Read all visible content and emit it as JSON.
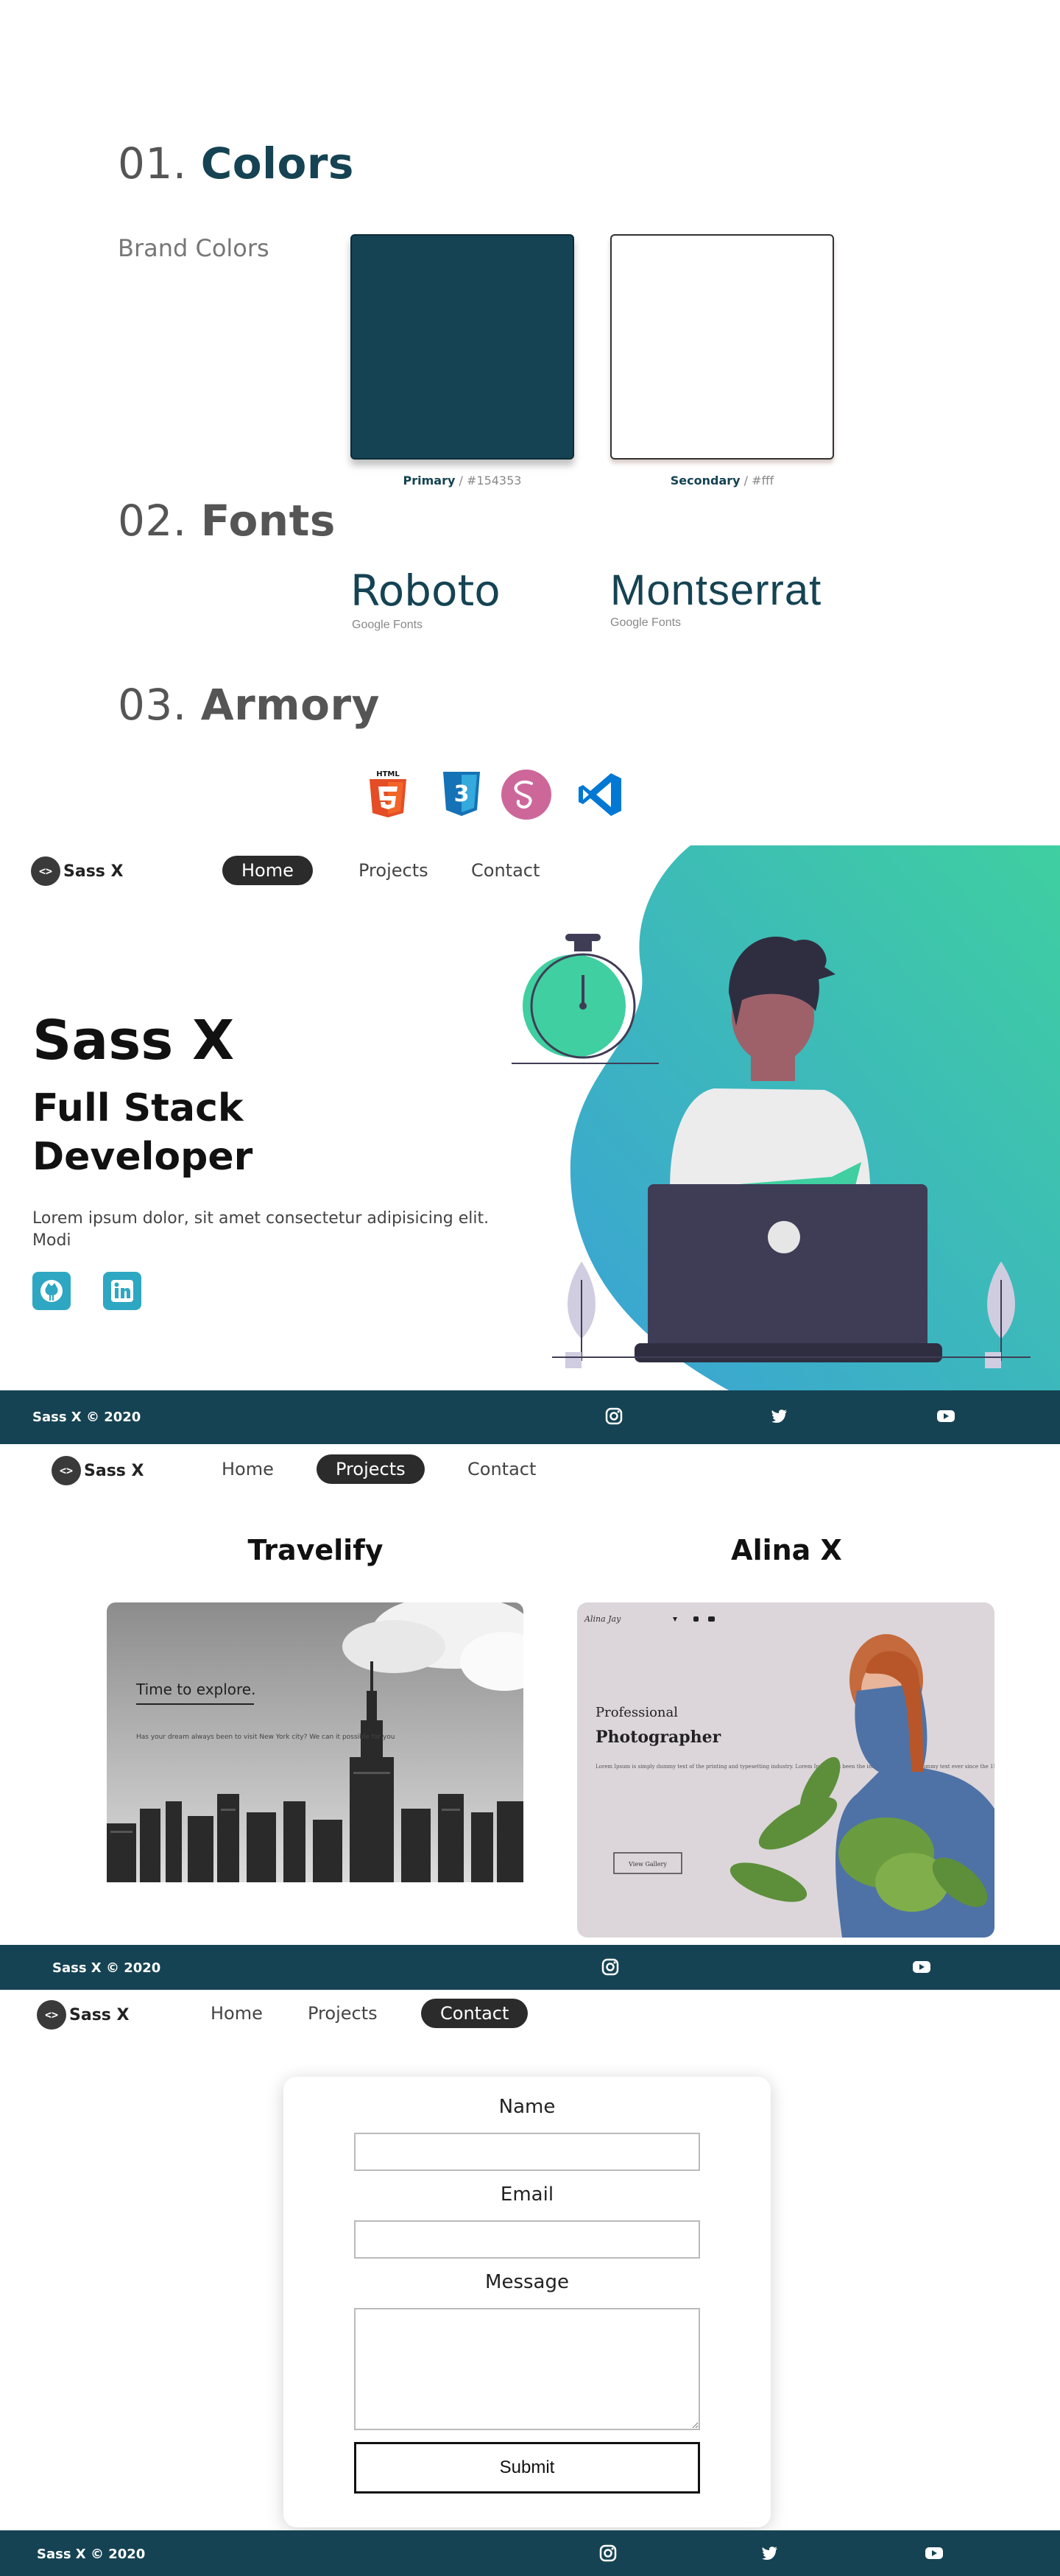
{
  "styleguide": {
    "colors": {
      "num": "01.",
      "name": "Colors",
      "brand_label": "Brand Colors",
      "primary": {
        "label": "Primary",
        "sep": " / ",
        "value": "#154353",
        "hex": "#154353"
      },
      "secondary": {
        "label": "Secondary",
        "sep": " / ",
        "value": "#fff",
        "hex": "#ffffff"
      }
    },
    "fonts": {
      "num": "02.",
      "name": "Fonts",
      "items": [
        {
          "name": "Roboto",
          "source": "Google Fonts"
        },
        {
          "name": "Montserrat",
          "source": "Google Fonts"
        }
      ]
    },
    "armory": {
      "num": "03.",
      "name": "Armory",
      "icons": [
        "html5-icon",
        "css3-icon",
        "sass-icon",
        "vscode-icon"
      ],
      "html5_text": "HTML"
    }
  },
  "brand": {
    "logo_glyph": "<>",
    "name": "Sass X"
  },
  "nav": {
    "home": "Home",
    "projects": "Projects",
    "contact": "Contact"
  },
  "hero": {
    "title": "Sass X",
    "subtitle": "Full Stack Developer",
    "text": "Lorem ipsum dolor, sit amet consectetur adipisicing elit. Modi",
    "socials": [
      "github-icon",
      "linkedin-icon"
    ]
  },
  "footer": {
    "copyright": "Sass X © 2020",
    "icons": [
      "instagram-icon",
      "twitter-icon",
      "youtube-icon"
    ]
  },
  "projects": [
    {
      "title": "Travelify",
      "preview_heading": "Time to explore.",
      "preview_text": "Has your dream always been to visit New York city? We can it possible for you"
    },
    {
      "title": "Alina X",
      "preview_logo": "Alina Jay",
      "preview_heading_1": "Professional",
      "preview_heading_2": "Photographer",
      "preview_text": "Lorem Ipsum is simply dummy text of the printing and typesetting industry. Lorem Ipsum has been the industry's standard dummy text ever since the 1500s",
      "preview_button": "View Gallery"
    }
  ],
  "contact": {
    "name_label": "Name",
    "email_label": "Email",
    "message_label": "Message",
    "submit": "Submit",
    "name_value": "",
    "email_value": "",
    "message_value": ""
  },
  "colors": {
    "primary": "#154353",
    "accent_gradient_start": "#3aa2d6",
    "accent_gradient_end": "#3fcfa0",
    "nav_active": "#2b2b2b",
    "social_button": "#2ea7c2"
  }
}
